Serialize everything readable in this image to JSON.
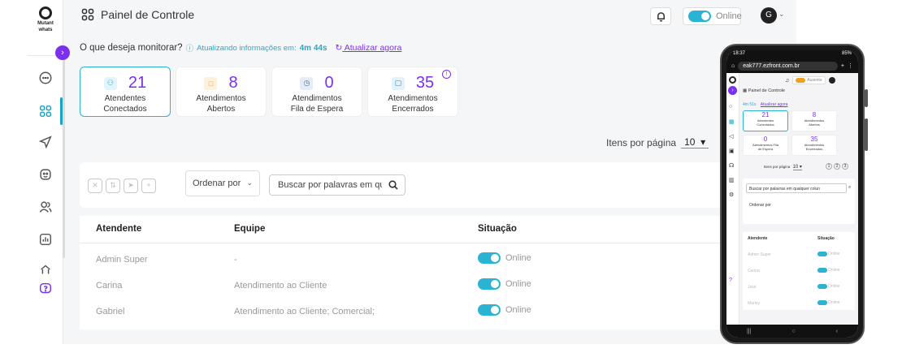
{
  "header": {
    "title": "Painel de Controle",
    "status_label": "Online",
    "avatar_initial": "G"
  },
  "sidebar": {
    "logo_line1": "Mutant",
    "logo_line2": "whats",
    "items": [
      {
        "icon": "chat-bubble-icon"
      },
      {
        "icon": "dashboard-grid-icon",
        "active": true
      },
      {
        "icon": "send-icon"
      },
      {
        "icon": "bot-icon"
      },
      {
        "icon": "users-icon"
      },
      {
        "icon": "chart-icon"
      },
      {
        "icon": "network-icon"
      },
      {
        "icon": "help-chat-icon"
      }
    ]
  },
  "monitor": {
    "question": "O que deseja monitorar?",
    "updating_label": "Atualizando informações em:",
    "timer": "4m 44s",
    "refresh_label": "Atualizar agora"
  },
  "cards": [
    {
      "value": "21",
      "label_line1": "Atendentes",
      "label_line2": "Conectados",
      "icon": "agents-icon"
    },
    {
      "value": "8",
      "label_line1": "Atendimentos",
      "label_line2": "Abertos",
      "icon": "open-chat-icon"
    },
    {
      "value": "0",
      "label_line1": "Atendimentos",
      "label_line2": "Fila de Espera",
      "icon": "clock-icon"
    },
    {
      "value": "35",
      "label_line1": "Atendimentos",
      "label_line2": "Encerrados",
      "icon": "closed-chat-icon"
    }
  ],
  "pagination": {
    "per_page_label": "Itens por página",
    "per_page_value": "10"
  },
  "toolbar": {
    "order_label": "Ordenar por",
    "search_placeholder": "Buscar por palavras em qualquer coluna"
  },
  "table": {
    "headers": [
      "Atendente",
      "Equipe",
      "Situação"
    ],
    "rows": [
      {
        "atendente": "Admin Super",
        "equipe": "-",
        "situacao": "Online"
      },
      {
        "atendente": "Carina",
        "equipe": "Atendimento ao Cliente",
        "situacao": "Online"
      },
      {
        "atendente": "Gabriel",
        "equipe": "Atendimento ao Cliente;  Comercial;",
        "situacao": "Online"
      }
    ]
  },
  "phone": {
    "time": "18:37",
    "battery": "85%",
    "url": "eak777.ezfront.com.br",
    "title": "Painel de Controle",
    "timer": "4m 51s",
    "refresh_label": "Atualizar agora",
    "status_label": "Ausente",
    "cards": [
      {
        "value": "21",
        "label_line1": "Atendentes",
        "label_line2": "Conectados"
      },
      {
        "value": "8",
        "label_line1": "Atendimentos",
        "label_line2": "Abertos"
      },
      {
        "value": "0",
        "label_line1": "Atendimentos Fila",
        "label_line2": "de Espera"
      },
      {
        "value": "35",
        "label_line1": "Atendimentos",
        "label_line2": "Encerrados"
      }
    ],
    "per_page_label": "Itens por página",
    "per_page_value": "10",
    "pages": [
      "1",
      "2",
      "3"
    ],
    "search_placeholder": "Buscar por palavras em qualquer colun",
    "order_label": "Ordenar por",
    "headers": [
      "Atendente",
      "Situação"
    ],
    "rows": [
      {
        "atendente": "Admin Super",
        "situacao": "Online"
      },
      {
        "atendente": "Carina",
        "situacao": "Online"
      },
      {
        "atendente": "José",
        "situacao": "Online"
      },
      {
        "atendente": "Marley",
        "situacao": "Online"
      }
    ]
  }
}
